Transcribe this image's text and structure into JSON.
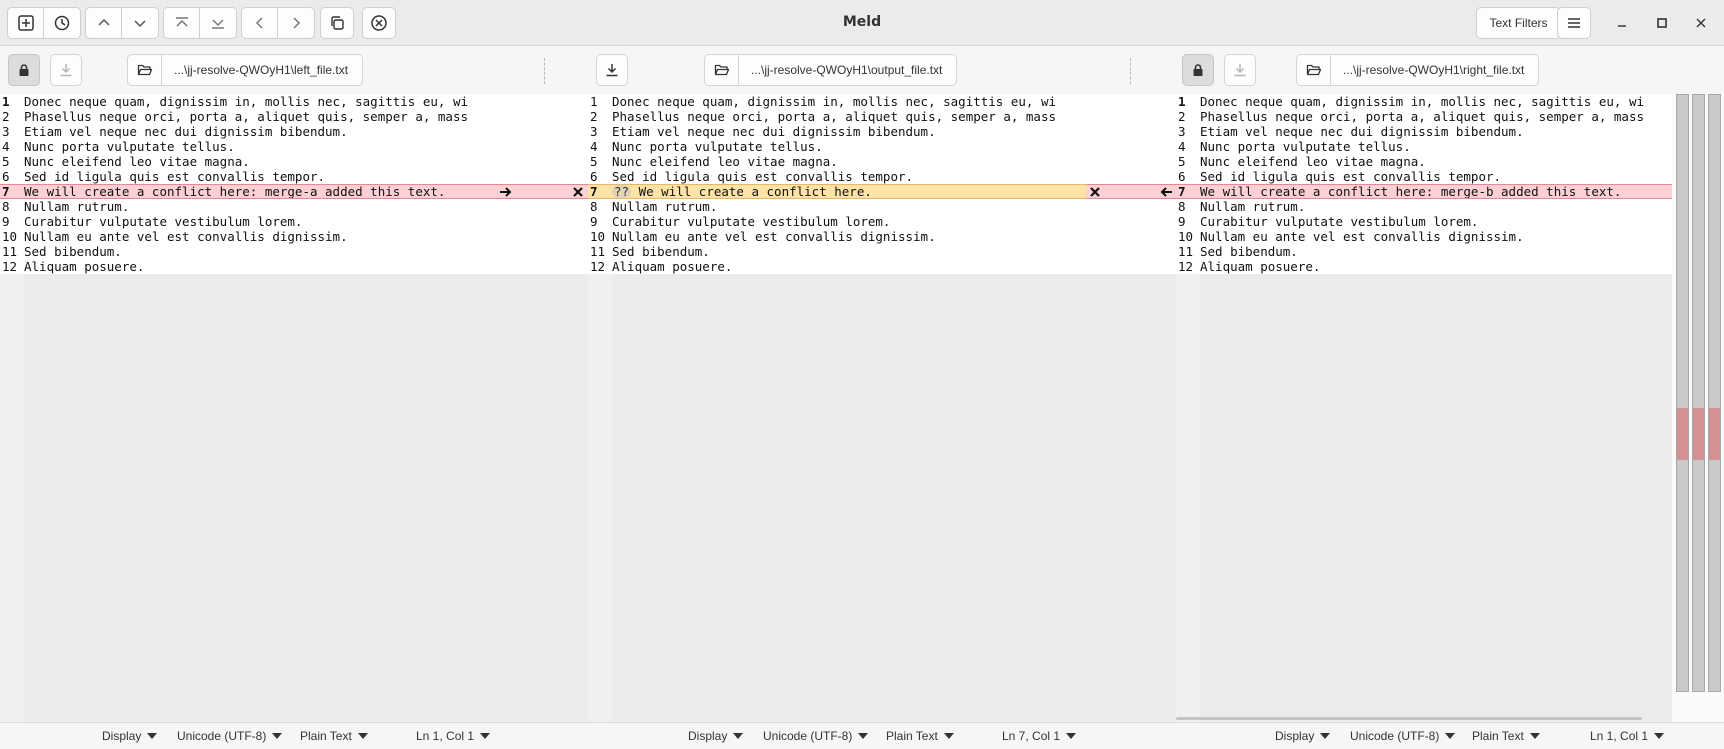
{
  "app": {
    "title": "Meld"
  },
  "header": {
    "text_filters_label": "Text Filters"
  },
  "panes": [
    {
      "path": "...\\jj-resolve-QWOyH1\\left_file.txt",
      "status": {
        "display": "Display",
        "encoding": "Unicode (UTF-8)",
        "syntax": "Plain Text",
        "position": "Ln 1, Col 1"
      }
    },
    {
      "path": "...\\jj-resolve-QWOyH1\\output_file.txt",
      "status": {
        "display": "Display",
        "encoding": "Unicode (UTF-8)",
        "syntax": "Plain Text",
        "position": "Ln 7, Col 1"
      }
    },
    {
      "path": "...\\jj-resolve-QWOyH1\\right_file.txt",
      "status": {
        "display": "Display",
        "encoding": "Unicode (UTF-8)",
        "syntax": "Plain Text",
        "position": "Ln 1, Col 1"
      }
    }
  ],
  "left_lines": [
    {
      "n": "1",
      "t": "Donec neque quam, dignissim in, mollis nec, sagittis eu, wi"
    },
    {
      "n": "2",
      "t": "Phasellus neque orci, porta a, aliquet quis, semper a, mass"
    },
    {
      "n": "3",
      "t": "Etiam vel neque nec dui dignissim bibendum."
    },
    {
      "n": "4",
      "t": "Nunc porta vulputate tellus."
    },
    {
      "n": "5",
      "t": "Nunc eleifend leo vitae magna."
    },
    {
      "n": "6",
      "t": "Sed id ligula quis est convallis tempor."
    },
    {
      "n": "7",
      "t": "We will create a conflict here: merge-a added this text."
    },
    {
      "n": "8",
      "t": "Nullam rutrum."
    },
    {
      "n": "9",
      "t": "Curabitur vulputate vestibulum lorem."
    },
    {
      "n": "10",
      "t": "Nullam eu ante vel est convallis dignissim."
    },
    {
      "n": "11",
      "t": "Sed bibendum."
    },
    {
      "n": "12",
      "t": "Aliquam posuere."
    }
  ],
  "mid_lines": [
    {
      "n": "1",
      "t": "Donec neque quam, dignissim in, mollis nec, sagittis eu, wi"
    },
    {
      "n": "2",
      "t": "Phasellus neque orci, porta a, aliquet quis, semper a, mass"
    },
    {
      "n": "3",
      "t": "Etiam vel neque nec dui dignissim bibendum."
    },
    {
      "n": "4",
      "t": "Nunc porta vulputate tellus."
    },
    {
      "n": "5",
      "t": "Nunc eleifend leo vitae magna."
    },
    {
      "n": "6",
      "t": "Sed id ligula quis est convallis tempor."
    },
    {
      "n": "7",
      "t": "We will create a conflict here.",
      "badge": "??"
    },
    {
      "n": "8",
      "t": "Nullam rutrum."
    },
    {
      "n": "9",
      "t": "Curabitur vulputate vestibulum lorem."
    },
    {
      "n": "10",
      "t": "Nullam eu ante vel est convallis dignissim."
    },
    {
      "n": "11",
      "t": "Sed bibendum."
    },
    {
      "n": "12",
      "t": "Aliquam posuere."
    }
  ],
  "right_lines": [
    {
      "n": "1",
      "t": "Donec neque quam, dignissim in, mollis nec, sagittis eu, wi"
    },
    {
      "n": "2",
      "t": "Phasellus neque orci, porta a, aliquet quis, semper a, mass"
    },
    {
      "n": "3",
      "t": "Etiam vel neque nec dui dignissim bibendum."
    },
    {
      "n": "4",
      "t": "Nunc porta vulputate tellus."
    },
    {
      "n": "5",
      "t": "Nunc eleifend leo vitae magna."
    },
    {
      "n": "6",
      "t": "Sed id ligula quis est convallis tempor."
    },
    {
      "n": "7",
      "t": "We will create a conflict here: merge-b added this text."
    },
    {
      "n": "8",
      "t": "Nullam rutrum."
    },
    {
      "n": "9",
      "t": "Curabitur vulputate vestibulum lorem."
    },
    {
      "n": "10",
      "t": "Nullam eu ante vel est convallis dignissim."
    },
    {
      "n": "11",
      "t": "Sed bibendum."
    },
    {
      "n": "12",
      "t": "Aliquam posuere."
    }
  ],
  "colors": {
    "conflict": "#fcd0d4",
    "current_chunk": "#fde3a6",
    "overview_marker": "#d49093"
  }
}
